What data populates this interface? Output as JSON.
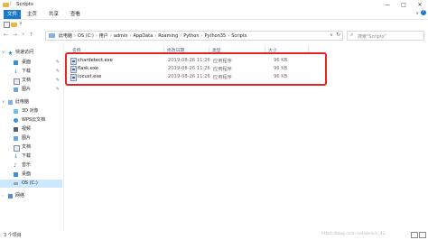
{
  "window": {
    "title": "Scripts",
    "minimize": "—",
    "maximize": "□",
    "close": "✕"
  },
  "ribbon": {
    "tabs": [
      "文件",
      "主页",
      "共享",
      "查看"
    ],
    "expand": "∨",
    "help": "?"
  },
  "quick_access_toolbar": {
    "dropdown": "∨"
  },
  "address": {
    "crumbs": [
      "此电脑",
      "OS (C:)",
      "用户",
      "admin",
      "AppData",
      "Roaming",
      "Python",
      "Python35",
      "Scripts"
    ],
    "dropdown": "∨",
    "refresh": "↻"
  },
  "search": {
    "placeholder": "搜索\"Scripts\""
  },
  "nav": {
    "items": [
      {
        "label": "快速访问",
        "type": "head"
      },
      {
        "label": "桌面",
        "pinned": true
      },
      {
        "label": "下载",
        "pinned": true
      },
      {
        "label": "文档",
        "pinned": true
      },
      {
        "label": "图片",
        "pinned": true
      },
      {
        "label": "此电脑",
        "type": "head"
      },
      {
        "label": "3D 对象"
      },
      {
        "label": "WPS云文档"
      },
      {
        "label": "视频"
      },
      {
        "label": "图片"
      },
      {
        "label": "文档"
      },
      {
        "label": "下载"
      },
      {
        "label": "音乐"
      },
      {
        "label": "桌面"
      },
      {
        "label": "OS (C:)",
        "selected": true
      },
      {
        "label": "网络",
        "type": "head"
      }
    ]
  },
  "columns": {
    "name": "名称",
    "date": "修改日期",
    "type": "类型",
    "size": "大小"
  },
  "files": [
    {
      "name": "chardetect.exe",
      "date": "2019-08-26 11:26",
      "type": "应用程序",
      "size": "96 KB"
    },
    {
      "name": "flask.exe",
      "date": "2019-08-26 11:26",
      "type": "应用程序",
      "size": "96 KB"
    },
    {
      "name": "locust.exe",
      "date": "2019-08-26 11:26",
      "type": "应用程序",
      "size": "96 KB"
    }
  ],
  "status": {
    "count": "3 个项目"
  },
  "watermark": "https://blog.csdn.net/weixin_42",
  "colors": {
    "accent": "#1979ca",
    "highlight_border": "#e0252b",
    "selected_bg": "#cce8ff"
  }
}
